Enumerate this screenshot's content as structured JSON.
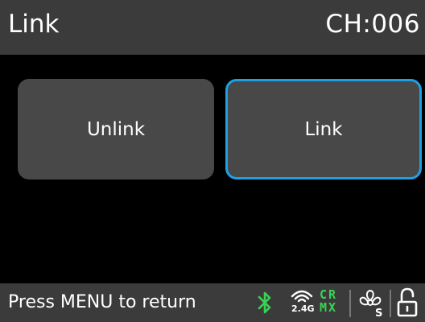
{
  "header": {
    "title": "Link",
    "channel": "CH:006"
  },
  "buttons": {
    "unlink_label": "Unlink",
    "link_label": "Link",
    "selected": "Link"
  },
  "footer": {
    "hint": "Press MENU to return"
  },
  "status_icons": {
    "bluetooth": "bluetooth-icon",
    "wireless": "wireless-2.4g-icon",
    "wireless_band": "2.4G",
    "crmx_top": "CR",
    "crmx_bottom": "MX",
    "fan": "fan-icon",
    "fan_mode": "S",
    "lock": "unlocked-padlock-icon"
  },
  "colors": {
    "header_bg": "#3b3b3b",
    "button_bg": "#484848",
    "selected_border": "#1ea0e6",
    "accent_green": "#39d353"
  }
}
